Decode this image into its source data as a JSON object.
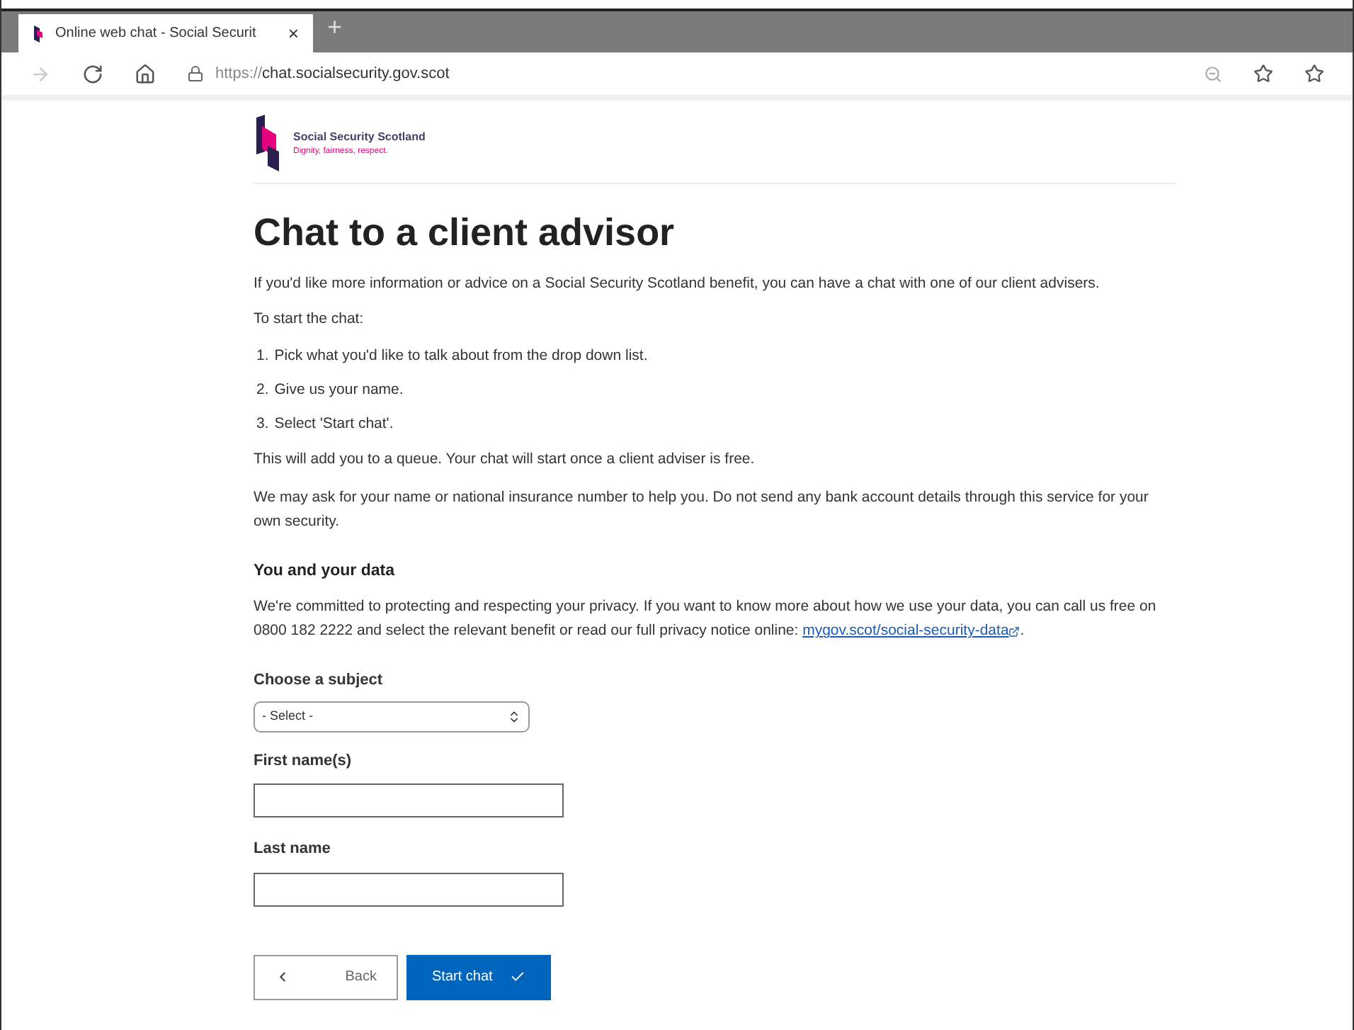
{
  "browser": {
    "tab_title": "Online web chat - Social Securit",
    "tab_close": "×",
    "new_tab": "+",
    "url_scheme": "https://",
    "url_host": "chat.socialsecurity.gov.scot"
  },
  "logo": {
    "name": "Social Security Scotland",
    "tagline": "Dignity, fairness, respect."
  },
  "page": {
    "heading": "Chat to a client advisor",
    "intro": "If you'd like more information or advice on a Social Security Scotland benefit, you can have a chat with one of our client advisers.",
    "steps_intro": "To start the chat:",
    "steps": [
      {
        "number": "1.",
        "text": "Pick what you'd like to talk about from the drop down list."
      },
      {
        "number": "2.",
        "text": "Give us your name."
      },
      {
        "number": "3.",
        "text": "Select 'Start chat'."
      }
    ],
    "queue_note": "This will add you to a queue. Your chat will start once a client adviser is free.",
    "security_note": "We may ask for your name or national insurance number to help you. Do not send any bank account details through this service for your own security.",
    "data_heading": "You and your data",
    "data_text": "We're committed to protecting and respecting your privacy. If you want to know more about how we use your data, you can call us free on 0800 182 2222 and select the relevant benefit or read our full privacy notice online:",
    "data_link": "mygov.scot/social-security-data",
    "data_end": "."
  },
  "form": {
    "subject_label": "Choose a subject",
    "subject_value": "- Select -",
    "first_name_label": "First name(s)",
    "last_name_label": "Last name"
  },
  "buttons": {
    "back": "Back",
    "start": "Start chat"
  }
}
